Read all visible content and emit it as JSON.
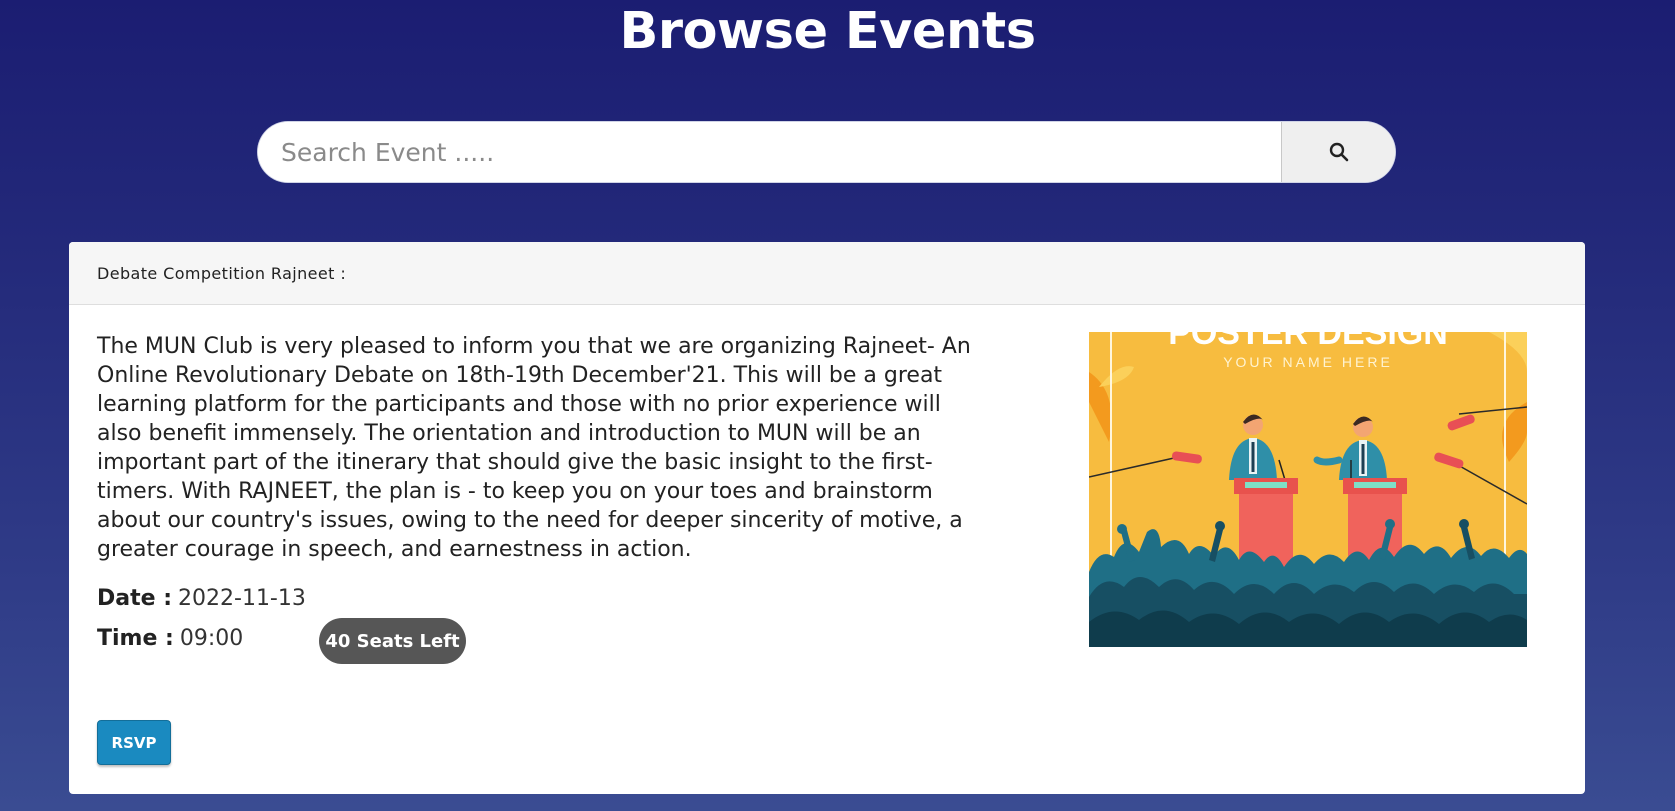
{
  "page": {
    "title": "Browse Events"
  },
  "search": {
    "placeholder": "Search Event .....",
    "value": "",
    "button_icon": "search-icon"
  },
  "event": {
    "header": "Debate Competition Rajneet :",
    "description": "The MUN Club is very pleased to inform you that we are organizing Rajneet- An Online Revolutionary Debate on 18th-19th December'21. This will be a great learning platform for the participants and those with no prior experience will also benefit immensely. The orientation and introduction to MUN will be an important part of the itinerary that should give the basic insight to the first-timers. With RAJNEET, the plan is - to keep you on your toes and brainstorm about our country's issues, owing to the need for deeper sincerity of motive, a greater courage in speech, and earnestness in action.",
    "date_label": "Date :",
    "date_value": "2022-11-13",
    "time_label": "Time :",
    "time_value": "09:00",
    "seats_badge": "40 Seats Left",
    "rsvp_label": "RSVP",
    "poster": {
      "title_text": "POSTER DESIGN",
      "subtitle_text": "YOUR NAME HERE"
    }
  },
  "colors": {
    "background_top": "#1b1d72",
    "background_bottom": "#3a4c92",
    "rsvp_button": "#1a8ac0",
    "seats_badge": "#565656",
    "poster_background": "#f7bc3f",
    "podium": "#f0635c"
  }
}
